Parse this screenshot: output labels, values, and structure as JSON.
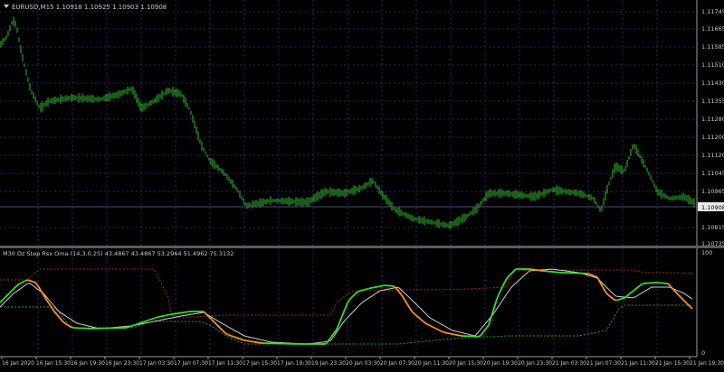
{
  "main_panel": {
    "header": "EURUSD,M15  1.10918 1.10925 1.10903 1.10908",
    "price_levels": [
      "1.11745",
      "1.11665",
      "1.11585",
      "1.11510",
      "1.11430",
      "1.11355",
      "1.11280",
      "1.11200",
      "1.11120",
      "1.11045",
      "1.10965",
      "1.10815",
      "1.10735"
    ],
    "current_price": "1.10908"
  },
  "indicator_panel": {
    "header": "M30 Dz Step Rsx Oma (14,3.0,25) 43.4867 43.4867 53.2964 51.4962 75.3132",
    "levels": [
      "100",
      "0"
    ]
  },
  "time_axis": [
    "16 Jan 2020",
    "16 Jan 15:30",
    "16 Jan 19:30",
    "16 Jan 23:30",
    "17 Jan 03:30",
    "17 Jan 07:30",
    "17 Jan 11:30",
    "17 Jan 15:30",
    "17 Jan 19:30",
    "19 Jan 23:30",
    "20 Jan 03:30",
    "20 Jan 07:30",
    "20 Jan 11:30",
    "20 Jan 15:30",
    "20 Jan 19:30",
    "20 Jan 23:30",
    "21 Jan 03:30",
    "21 Jan 07:30",
    "21 Jan 11:30",
    "21 Jan 15:30",
    "21 Jan 19:30"
  ],
  "colors": {
    "background": "#000000",
    "grid": "#1e2a6e",
    "candle": "#2fbd2f",
    "text": "#c8c8c8",
    "rsx_up": "#33dd33",
    "rsx_down": "#ff9020",
    "signal": "#d0d0d0",
    "upper_level": "#aa2a1a",
    "lower_level": "#22aa22"
  }
}
